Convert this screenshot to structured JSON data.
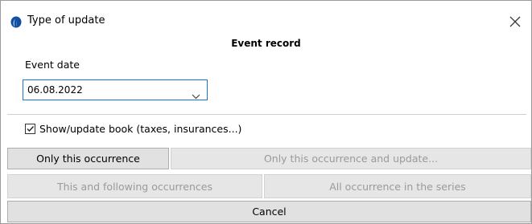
{
  "window": {
    "title": "Type of update",
    "close_icon": "close-icon",
    "app_icon": "app-logo-icon"
  },
  "form": {
    "heading": "Event record",
    "event_date_label": "Event date",
    "event_date_value": "06.08.2022",
    "show_update_book_label": "Show/update book (taxes, insurances...)",
    "show_update_book_checked": true
  },
  "buttons": {
    "only_this": "Only this occurrence",
    "only_this_and_update": "Only this occurrence and update...",
    "this_and_following": "This and following occurrences",
    "all_in_series": "All occurrence in the series",
    "cancel": "Cancel"
  },
  "colors": {
    "accent": "#1a73d9",
    "button_bg": "#e1e1e1",
    "disabled_text": "#9a9a9a"
  }
}
